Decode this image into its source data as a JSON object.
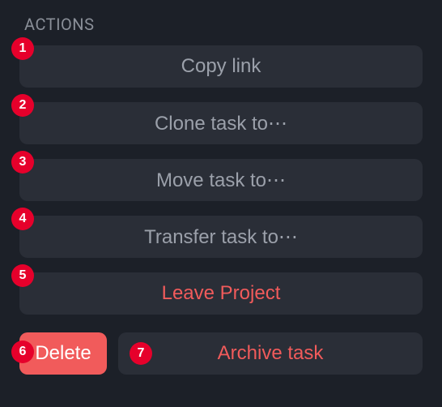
{
  "section_title": "ACTIONS",
  "actions": {
    "copy_link": {
      "label": "Copy link",
      "badge": "1"
    },
    "clone_task": {
      "label": "Clone task to⋯",
      "badge": "2"
    },
    "move_task": {
      "label": "Move task to⋯",
      "badge": "3"
    },
    "transfer_task": {
      "label": "Transfer task to⋯",
      "badge": "4"
    },
    "leave_project": {
      "label": "Leave Project",
      "badge": "5"
    },
    "delete": {
      "label": "Delete",
      "badge": "6"
    },
    "archive": {
      "label": "Archive task",
      "badge": "7"
    }
  },
  "colors": {
    "background": "#1c2028",
    "button_bg": "#2a2e37",
    "text_muted": "#9ba0aa",
    "danger": "#f15b5b",
    "badge": "#e6002b"
  }
}
